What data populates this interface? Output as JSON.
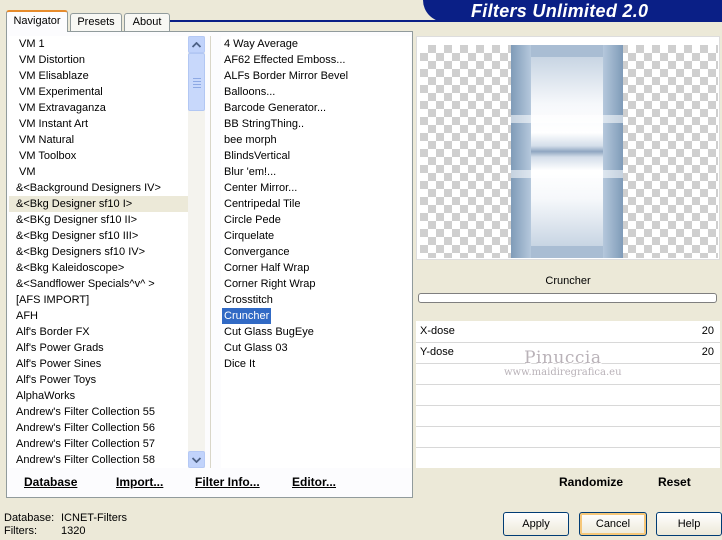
{
  "title": "Filters Unlimited 2.0",
  "tabs": [
    {
      "label": "Navigator",
      "active": true
    },
    {
      "label": "Presets",
      "active": false
    },
    {
      "label": "About",
      "active": false
    }
  ],
  "categories": [
    "VM 1",
    "VM Distortion",
    "VM Elisablaze",
    "VM Experimental",
    "VM Extravaganza",
    "VM Instant Art",
    "VM Natural",
    "VM Toolbox",
    "VM",
    "&<Background Designers IV>",
    "&<Bkg Designer sf10 I>",
    "&<BKg Designer sf10 II>",
    "&<Bkg Designer sf10 III>",
    "&<Bkg Designers sf10 IV>",
    "&<Bkg Kaleidoscope>",
    "&<Sandflower Specials^v^ >",
    "[AFS IMPORT]",
    "AFH",
    "Alf's Border FX",
    "Alf's Power Grads",
    "Alf's Power Sines",
    "Alf's Power Toys",
    "AlphaWorks",
    "Andrew's Filter Collection 55",
    "Andrew's Filter Collection 56",
    "Andrew's Filter Collection 57",
    "Andrew's Filter Collection 58"
  ],
  "selected_category": "&<Bkg Designer sf10 I>",
  "filters": [
    "4 Way Average",
    "AF62 Effected Emboss...",
    "ALFs Border Mirror Bevel",
    "Balloons...",
    "Barcode Generator...",
    "BB StringThing..",
    "bee morph",
    "BlindsVertical",
    "Blur 'em!...",
    "Center Mirror...",
    "Centripedal Tile",
    "Circle Pede",
    "Cirquelate",
    "Convergance",
    "Corner Half Wrap",
    "Corner Right Wrap",
    "Crosstitch",
    "Cruncher",
    "Cut Glass  BugEye",
    "Cut Glass 03",
    "Dice It"
  ],
  "selected_filter": "Cruncher",
  "bottom_links": {
    "database": "Database",
    "import": "Import...",
    "filter_info": "Filter Info...",
    "editor": "Editor..."
  },
  "preview_filter_name": "Cruncher",
  "params": [
    {
      "label": "X-dose",
      "value": "20"
    },
    {
      "label": "Y-dose",
      "value": "20"
    }
  ],
  "watermark": {
    "line1": "Pinuccia",
    "line2": "www.maidiregrafica.eu"
  },
  "actions": {
    "randomize": "Randomize",
    "reset": "Reset"
  },
  "status": {
    "database_label": "Database:",
    "database_value": "ICNET-Filters",
    "filters_label": "Filters:",
    "filters_value": "1320"
  },
  "buttons": {
    "apply": "Apply",
    "cancel": "Cancel",
    "help": "Help"
  },
  "colors": {
    "banner": "#0a1f86",
    "selection": "#316ac5",
    "tab_accent": "#e68b2c"
  }
}
